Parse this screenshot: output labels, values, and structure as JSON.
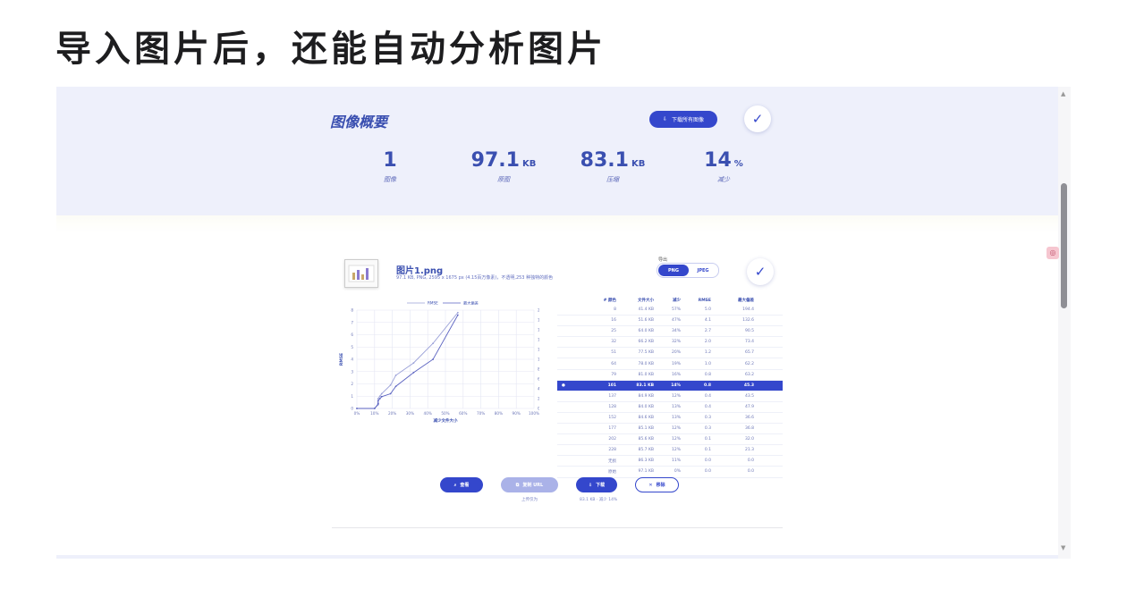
{
  "headline": "导入图片后，还能自动分析图片",
  "summary": {
    "title": "图像概要",
    "download_all_label": "下载所有图像",
    "stats": [
      {
        "value": "1",
        "unit": "",
        "label": "图像"
      },
      {
        "value": "97.1",
        "unit": "KB",
        "label": "原图"
      },
      {
        "value": "83.1",
        "unit": "KB",
        "label": "压缩"
      },
      {
        "value": "14",
        "unit": "%",
        "label": "减少"
      }
    ]
  },
  "file": {
    "name": "图片1.png",
    "meta": "97.1 KB, PNG, 2595 x 1675 px (4.15百万像素)，不透明,253 种独特的颜色"
  },
  "format": {
    "label": "导出",
    "options": [
      "PNG",
      "JPEG"
    ],
    "selected": "PNG"
  },
  "chart_data": {
    "type": "line",
    "legend": [
      "RMSE",
      "最大偏差"
    ],
    "xlabel": "减少文件大小",
    "ylabel_left": "RMSE",
    "ylabel_right": "最大偏差",
    "x_ticks": [
      "0%",
      "10%",
      "20%",
      "30%",
      "40%",
      "50%",
      "60%",
      "70%",
      "80%",
      "90%",
      "100%"
    ],
    "y_left_ticks": [
      "0",
      "1",
      "2",
      "3",
      "4",
      "5",
      "6",
      "7",
      "8"
    ],
    "y_right_ticks": [
      "0",
      "20",
      "40",
      "60",
      "80",
      "100",
      "120",
      "140",
      "160",
      "180",
      "200"
    ],
    "series": [
      {
        "name": "RMSE",
        "x": [
          0,
          10,
          12,
          12,
          12,
          13,
          14,
          19,
          22,
          32,
          43,
          57
        ],
        "y": [
          0,
          0,
          0.3,
          0.4,
          0.8,
          1.0,
          1.2,
          1.9,
          2.7,
          3.7,
          5.3,
          7.8
        ]
      },
      {
        "name": "最大偏差",
        "x": [
          0,
          10,
          12,
          12,
          12,
          13,
          14,
          19,
          22,
          32,
          43,
          57
        ],
        "y": [
          0,
          0,
          9.2,
          10.5,
          15.5,
          20,
          24,
          30,
          45,
          73,
          100,
          190
        ]
      }
    ]
  },
  "table": {
    "headers": [
      "",
      "",
      "# 颜色",
      "文件大小",
      "减少",
      "RMSE",
      "最大偏差"
    ],
    "rows": [
      [
        "",
        "",
        "8",
        "41.4 KB",
        "57%",
        "5.0",
        "194.4"
      ],
      [
        "",
        "",
        "16",
        "51.6 KB",
        "47%",
        "4.1",
        "132.6"
      ],
      [
        "",
        "",
        "25",
        "64.0 KB",
        "34%",
        "2.7",
        "90.5"
      ],
      [
        "",
        "",
        "32",
        "66.2 KB",
        "32%",
        "2.0",
        "73.4"
      ],
      [
        "",
        "",
        "51",
        "77.5 KB",
        "20%",
        "1.2",
        "65.7"
      ],
      [
        "",
        "",
        "64",
        "78.0 KB",
        "19%",
        "1.0",
        "62.2"
      ],
      [
        "",
        "",
        "79",
        "81.0 KB",
        "16%",
        "0.8",
        "63.2"
      ],
      [
        "●",
        "",
        "101",
        "83.1 KB",
        "14%",
        "0.8",
        "45.3"
      ],
      [
        "",
        "",
        "137",
        "84.9 KB",
        "12%",
        "0.4",
        "43.5"
      ],
      [
        "",
        "",
        "128",
        "84.0 KB",
        "13%",
        "0.4",
        "47.9"
      ],
      [
        "",
        "",
        "152",
        "84.6 KB",
        "13%",
        "0.3",
        "36.6"
      ],
      [
        "",
        "",
        "177",
        "85.1 KB",
        "12%",
        "0.3",
        "36.8"
      ],
      [
        "",
        "",
        "202",
        "85.6 KB",
        "12%",
        "0.1",
        "32.0"
      ],
      [
        "",
        "",
        "228",
        "85.7 KB",
        "12%",
        "0.1",
        "21.3"
      ],
      [
        "",
        "",
        "无损",
        "86.3 KB",
        "11%",
        "0.0",
        "0.0"
      ],
      [
        "",
        "",
        "原始",
        "97.1 KB",
        "0%",
        "0.0",
        "0.0"
      ]
    ],
    "selected_row": 7
  },
  "actions": {
    "view_label": "查看",
    "copy_url_label": "复制 URL",
    "copy_url_sub": "上传仅为",
    "download_label": "下载",
    "download_sub": "83.1 KB · 减少 14%",
    "remove_label": "移除"
  },
  "colors": {
    "accent": "#3447cc",
    "summary_bg": "#eef0fb",
    "series_rmse": "#9aa0d8",
    "series_max": "#5a62c0"
  }
}
